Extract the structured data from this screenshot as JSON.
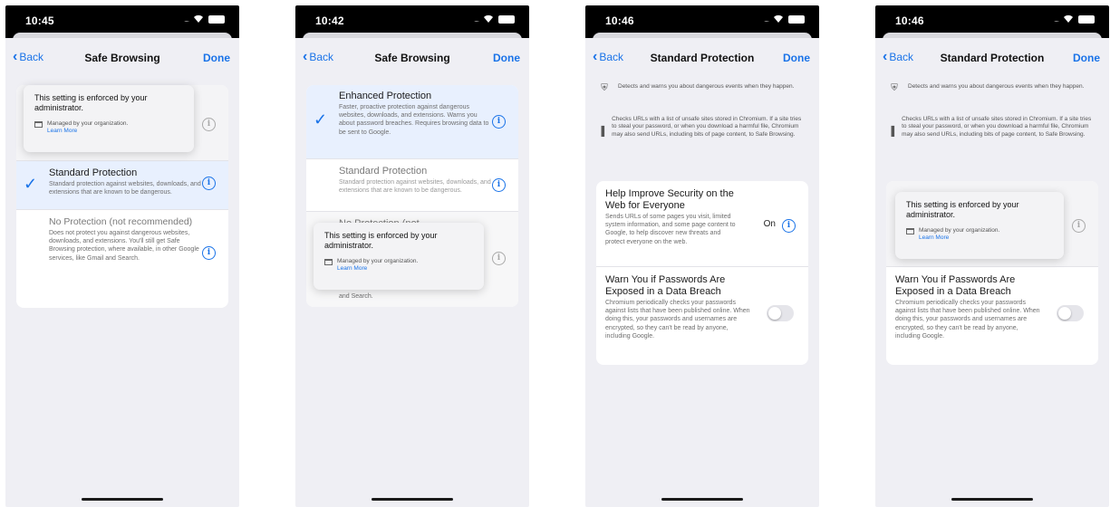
{
  "screens": [
    {
      "time": "10:45",
      "nav": {
        "back": "Back",
        "title": "Safe Browsing",
        "done": "Done"
      },
      "popover": {
        "title": "This setting is enforced by your administrator.",
        "managed": "Managed by your organization.",
        "link": "Learn More"
      },
      "rows": [
        {
          "title": "Standard Protection",
          "desc": "Standard protection against websites, downloads, and extensions that are known to be dangerous."
        },
        {
          "title": "No Protection (not recommended)",
          "desc": "Does not protect you against dangerous websites, downloads, and extensions. You'll still get Safe Browsing protection, where available, in other Google services, like Gmail and Search."
        }
      ]
    },
    {
      "time": "10:42",
      "nav": {
        "back": "Back",
        "title": "Safe Browsing",
        "done": "Done"
      },
      "rows": [
        {
          "title": "Enhanced Protection",
          "desc": "Faster, proactive protection against dangerous websites, downloads, and extensions. Warns you about password breaches. Requires browsing data to be sent to Google."
        },
        {
          "title": "Standard Protection",
          "desc": "Standard protection against websites, downloads, and extensions that are known to be dangerous."
        },
        {
          "title": "No Protection (not",
          "desc": "and Search."
        }
      ],
      "popover": {
        "title": "This setting is enforced by your administrator.",
        "managed": "Managed by your organization.",
        "link": "Learn More"
      }
    },
    {
      "time": "10:46",
      "nav": {
        "back": "Back",
        "title": "Standard Protection",
        "done": "Done"
      },
      "intro": [
        {
          "icon": "shield-icon",
          "text": "Detects and warns you about dangerous events when they happen."
        },
        {
          "icon": "bar-chart-icon",
          "text": "Checks URLs with a list of unsafe sites stored in Chromium. If a site tries to steal your password, or when you download a harmful file, Chromium may also send URLs, including bits of page content, to Safe Browsing."
        }
      ],
      "rows": [
        {
          "title": "Help Improve Security on the Web for Everyone",
          "desc": "Sends URLs of some pages you visit, limited system information, and some page content to Google, to help discover new threats and protect everyone on the web.",
          "state": "On"
        },
        {
          "title": "Warn You if Passwords Are Exposed in a Data Breach",
          "desc": "Chromium periodically checks your passwords against lists that have been published online. When doing this, your passwords and usernames are encrypted, so they can't be read by anyone, including Google."
        }
      ]
    },
    {
      "time": "10:46",
      "nav": {
        "back": "Back",
        "title": "Standard Protection",
        "done": "Done"
      },
      "intro": [
        {
          "icon": "shield-icon",
          "text": "Detects and warns you about dangerous events when they happen."
        },
        {
          "icon": "bar-chart-icon",
          "text": "Checks URLs with a list of unsafe sites stored in Chromium. If a site tries to steal your password, or when you download a harmful file, Chromium may also send URLs, including bits of page content, to Safe Browsing."
        }
      ],
      "popover": {
        "title": "This setting is enforced by your administrator.",
        "managed": "Managed by your organization.",
        "link": "Learn More"
      },
      "rows": [
        {
          "title": "Warn You if Passwords Are Exposed in a Data Breach",
          "desc": "Chromium periodically checks your passwords against lists that have been published online. When doing this, your passwords and usernames are encrypted, so they can't be read by anyone, including Google."
        }
      ]
    }
  ]
}
